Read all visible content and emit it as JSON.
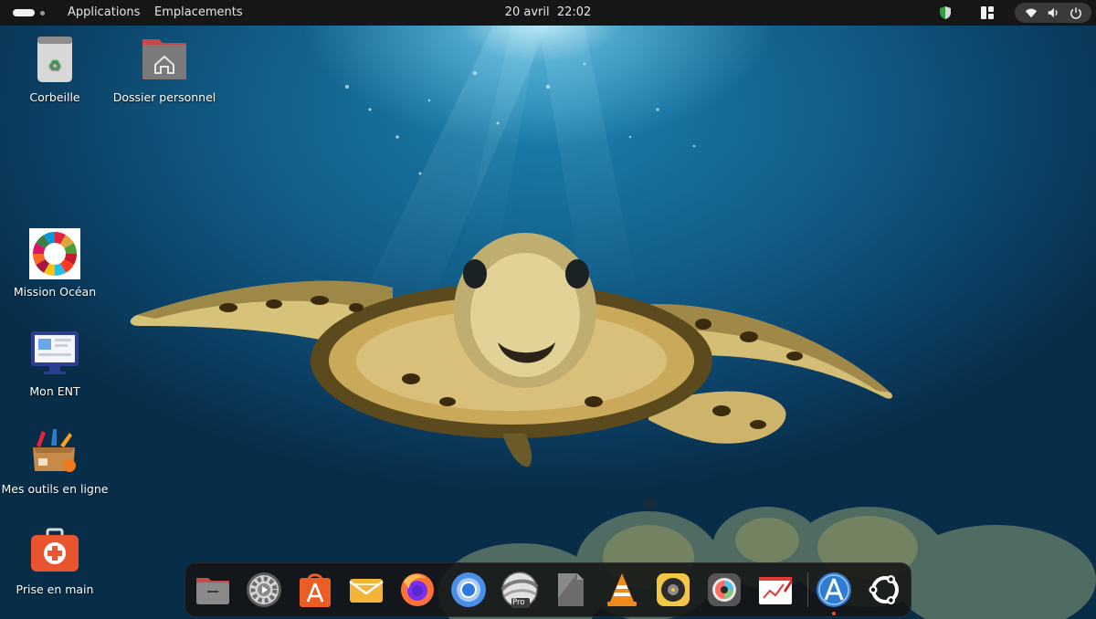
{
  "topbar": {
    "menu_applications": "Applications",
    "menu_places": "Emplacements",
    "clock_date": "20 avril",
    "clock_time": "22:02",
    "indicators": [
      "shield-icon",
      "layout-icon",
      "wifi-icon",
      "volume-icon",
      "power-icon"
    ]
  },
  "desktop": {
    "icons": [
      {
        "label": "Corbeille",
        "icon": "trash-icon"
      },
      {
        "label": "Dossier personnel",
        "icon": "home-folder-icon"
      },
      {
        "label": "Mission Océan",
        "icon": "mission-ocean-icon"
      },
      {
        "label": "Mon ENT",
        "icon": "ent-icon"
      },
      {
        "label": "Mes outils en ligne",
        "icon": "tools-box-icon"
      },
      {
        "label": "Prise en main",
        "icon": "first-aid-kit-icon"
      }
    ]
  },
  "dock": {
    "apps": [
      {
        "name": "files",
        "icon": "files-icon"
      },
      {
        "name": "settings",
        "icon": "settings-icon"
      },
      {
        "name": "app-center",
        "icon": "app-center-icon"
      },
      {
        "name": "mail",
        "icon": "mail-icon"
      },
      {
        "name": "firefox",
        "icon": "firefox-icon"
      },
      {
        "name": "chromium",
        "icon": "chromium-icon"
      },
      {
        "name": "google-earth-pro",
        "icon": "earth-pro-icon",
        "badge": "Pro"
      },
      {
        "name": "libreoffice",
        "icon": "libreoffice-icon"
      },
      {
        "name": "vlc",
        "icon": "vlc-icon"
      },
      {
        "name": "rhythmbox",
        "icon": "speaker-icon"
      },
      {
        "name": "photo-editor",
        "icon": "camera-icon"
      },
      {
        "name": "whiteboard",
        "icon": "whiteboard-icon"
      },
      {
        "name": "software-updater",
        "icon": "updater-icon",
        "running": true
      },
      {
        "name": "show-applications",
        "icon": "ubuntu-apps-icon"
      }
    ]
  },
  "colors": {
    "accent": "#e95420",
    "topbar": "#161616",
    "dock": "#141414",
    "water_light": "#1d7fae",
    "water_dark": "#082d49"
  }
}
